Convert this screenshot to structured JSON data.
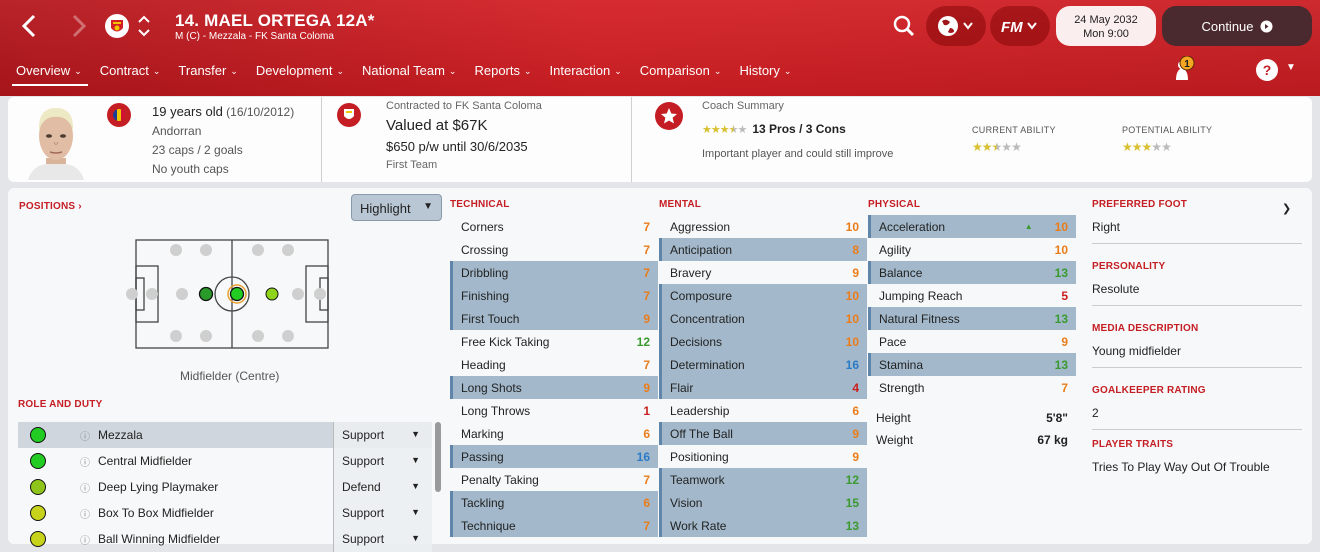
{
  "header": {
    "player_title": "14. MAEL ORTEGA 12A*",
    "player_subtitle": "M (C) - Mezzala - FK Santa Coloma",
    "date": "24 May 2032",
    "time": "Mon 9:00",
    "continue_label": "Continue",
    "notification_count": "1",
    "help_label": "?",
    "accent_color": "#c41e24"
  },
  "tabs": [
    {
      "label": "Overview",
      "active": true
    },
    {
      "label": "Contract"
    },
    {
      "label": "Transfer"
    },
    {
      "label": "Development"
    },
    {
      "label": "National Team"
    },
    {
      "label": "Reports"
    },
    {
      "label": "Interaction"
    },
    {
      "label": "Comparison"
    },
    {
      "label": "History"
    }
  ],
  "info": {
    "age": "19 years old",
    "dob": "(16/10/2012)",
    "nationality": "Andorran",
    "caps": "23 caps / 2 goals",
    "youth_caps": "No youth caps",
    "contracted_to": "Contracted to FK Santa Coloma",
    "value": "Valued at $67K",
    "wage": "$650 p/w until 30/6/2035",
    "squad": "First Team",
    "coach_summary_label": "Coach Summary",
    "pros_cons": "13 Pros / 3 Cons",
    "coach_stars": 3.5,
    "coach_comment": "Important player and could still improve",
    "current_ability_label": "CURRENT ABILITY",
    "current_ability_stars": 2.5,
    "potential_ability_label": "POTENTIAL ABILITY",
    "potential_ability_stars": 3
  },
  "positions": {
    "heading": "POSITIONS",
    "highlight_label": "Highlight",
    "position_label": "Midfielder (Centre)"
  },
  "roles": {
    "heading": "ROLE AND DUTY",
    "items": [
      {
        "name": "Mezzala",
        "duty": "Support",
        "color": "#22cc22"
      },
      {
        "name": "Central Midfielder",
        "duty": "Support",
        "color": "#22cc22"
      },
      {
        "name": "Deep Lying Playmaker",
        "duty": "Defend",
        "color": "#8fc41a"
      },
      {
        "name": "Box To Box Midfielder",
        "duty": "Support",
        "color": "#c7d21a"
      },
      {
        "name": "Ball Winning Midfielder",
        "duty": "Support",
        "color": "#c7d21a"
      }
    ]
  },
  "technical": {
    "heading": "TECHNICAL",
    "items": [
      {
        "name": "Corners",
        "value": "7",
        "hl": false
      },
      {
        "name": "Crossing",
        "value": "7",
        "hl": false
      },
      {
        "name": "Dribbling",
        "value": "7",
        "hl": true
      },
      {
        "name": "Finishing",
        "value": "7",
        "hl": true
      },
      {
        "name": "First Touch",
        "value": "9",
        "hl": true
      },
      {
        "name": "Free Kick Taking",
        "value": "12",
        "hl": false
      },
      {
        "name": "Heading",
        "value": "7",
        "hl": false
      },
      {
        "name": "Long Shots",
        "value": "9",
        "hl": true
      },
      {
        "name": "Long Throws",
        "value": "1",
        "hl": false
      },
      {
        "name": "Marking",
        "value": "6",
        "hl": false
      },
      {
        "name": "Passing",
        "value": "16",
        "hl": true
      },
      {
        "name": "Penalty Taking",
        "value": "7",
        "hl": false
      },
      {
        "name": "Tackling",
        "value": "6",
        "hl": true
      },
      {
        "name": "Technique",
        "value": "7",
        "hl": true
      }
    ]
  },
  "mental": {
    "heading": "MENTAL",
    "items": [
      {
        "name": "Aggression",
        "value": "10",
        "hl": false
      },
      {
        "name": "Anticipation",
        "value": "8",
        "hl": true
      },
      {
        "name": "Bravery",
        "value": "9",
        "hl": false
      },
      {
        "name": "Composure",
        "value": "10",
        "hl": true
      },
      {
        "name": "Concentration",
        "value": "10",
        "hl": true
      },
      {
        "name": "Decisions",
        "value": "10",
        "hl": true
      },
      {
        "name": "Determination",
        "value": "16",
        "hl": true
      },
      {
        "name": "Flair",
        "value": "4",
        "hl": true
      },
      {
        "name": "Leadership",
        "value": "6",
        "hl": false
      },
      {
        "name": "Off The Ball",
        "value": "9",
        "hl": true
      },
      {
        "name": "Positioning",
        "value": "9",
        "hl": false
      },
      {
        "name": "Teamwork",
        "value": "12",
        "hl": true
      },
      {
        "name": "Vision",
        "value": "15",
        "hl": true
      },
      {
        "name": "Work Rate",
        "value": "13",
        "hl": true
      }
    ]
  },
  "physical": {
    "heading": "PHYSICAL",
    "items": [
      {
        "name": "Acceleration",
        "value": "10",
        "hl": true
      },
      {
        "name": "Agility",
        "value": "10",
        "hl": false
      },
      {
        "name": "Balance",
        "value": "13",
        "hl": true
      },
      {
        "name": "Jumping Reach",
        "value": "5",
        "hl": false
      },
      {
        "name": "Natural Fitness",
        "value": "13",
        "hl": true
      },
      {
        "name": "Pace",
        "value": "9",
        "hl": false
      },
      {
        "name": "Stamina",
        "value": "13",
        "hl": true
      },
      {
        "name": "Strength",
        "value": "7",
        "hl": false
      }
    ],
    "height_label": "Height",
    "height": "5'8\"",
    "weight_label": "Weight",
    "weight": "67 kg"
  },
  "side": {
    "preferred_foot_label": "PREFERRED FOOT",
    "preferred_foot": "Right",
    "personality_label": "PERSONALITY",
    "personality": "Resolute",
    "media_label": "MEDIA DESCRIPTION",
    "media": "Young midfielder",
    "gk_label": "GOALKEEPER RATING",
    "gk": "2",
    "traits_label": "PLAYER TRAITS",
    "traits": "Tries To Play Way Out Of Trouble"
  }
}
